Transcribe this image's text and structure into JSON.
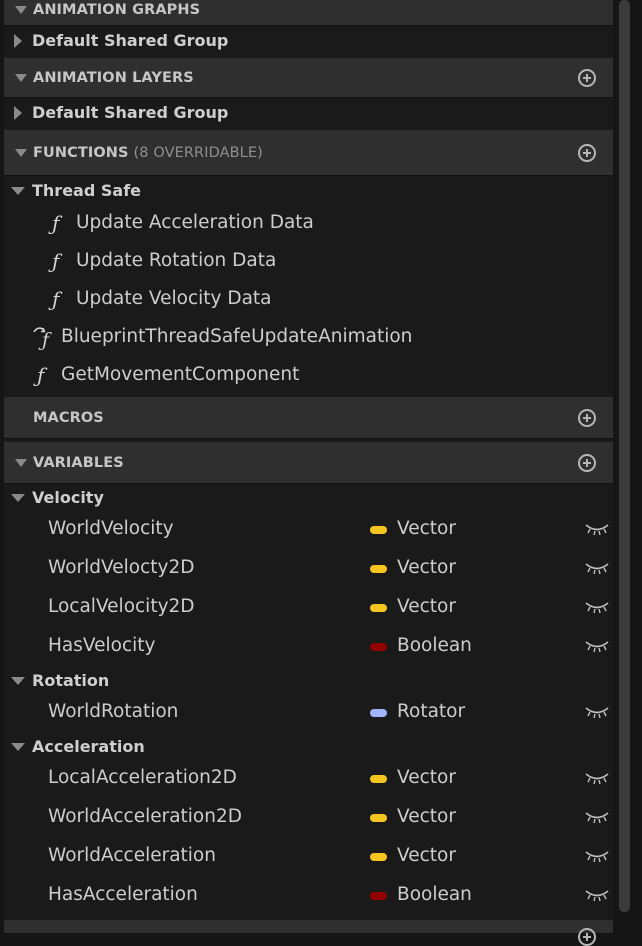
{
  "sections": {
    "animation_graphs": "ANIMATION GRAPHS",
    "animation_layers": "ANIMATION LAYERS",
    "functions": "FUNCTIONS",
    "functions_sub": "(8 OVERRIDABLE)",
    "macros": "MACROS",
    "variables": "VARIABLES"
  },
  "graph_groups": {
    "graphs_default": "Default Shared Group",
    "layers_default": "Default Shared Group"
  },
  "functions": {
    "category": "Thread Safe",
    "thread_safe_items": [
      "Update Acceleration Data",
      "Update Rotation Data",
      "Update Velocity Data"
    ],
    "override_item": "BlueprintThreadSafeUpdateAnimation",
    "other_item": "GetMovementComponent"
  },
  "variables": {
    "categories": [
      "Velocity",
      "Rotation",
      "Acceleration"
    ],
    "items": [
      {
        "name": "WorldVelocity",
        "type": "Vector"
      },
      {
        "name": "WorldVelocty2D",
        "type": "Vector"
      },
      {
        "name": "LocalVelocity2D",
        "type": "Vector"
      },
      {
        "name": "HasVelocity",
        "type": "Boolean"
      },
      {
        "name": "WorldRotation",
        "type": "Rotator"
      },
      {
        "name": "LocalAcceleration2D",
        "type": "Vector"
      },
      {
        "name": "WorldAcceleration2D",
        "type": "Vector"
      },
      {
        "name": "WorldAcceleration",
        "type": "Vector"
      },
      {
        "name": "HasAcceleration",
        "type": "Boolean"
      }
    ]
  },
  "type_colors": {
    "Vector": "#f7c520",
    "Boolean": "#920000",
    "Rotator": "#a0b4fb"
  }
}
